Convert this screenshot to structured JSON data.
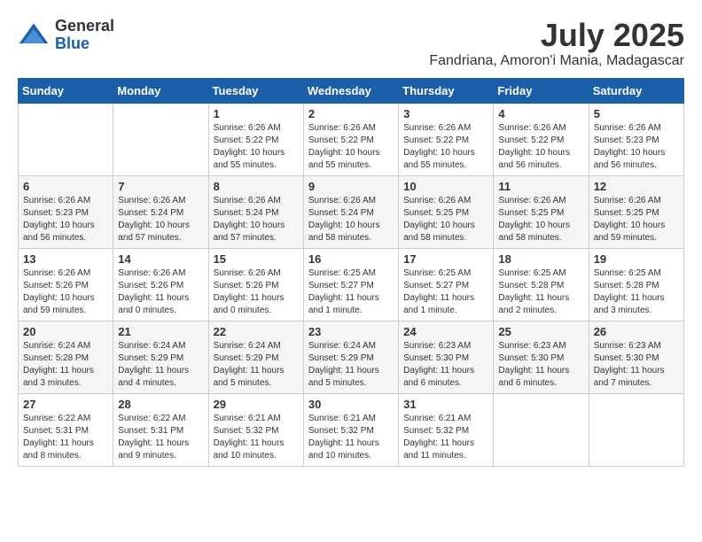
{
  "header": {
    "logo_general": "General",
    "logo_blue": "Blue",
    "month_year": "July 2025",
    "location": "Fandriana, Amoron'i Mania, Madagascar"
  },
  "weekdays": [
    "Sunday",
    "Monday",
    "Tuesday",
    "Wednesday",
    "Thursday",
    "Friday",
    "Saturday"
  ],
  "weeks": [
    [
      {
        "day": "",
        "info": ""
      },
      {
        "day": "",
        "info": ""
      },
      {
        "day": "1",
        "info": "Sunrise: 6:26 AM\nSunset: 5:22 PM\nDaylight: 10 hours\nand 55 minutes."
      },
      {
        "day": "2",
        "info": "Sunrise: 6:26 AM\nSunset: 5:22 PM\nDaylight: 10 hours\nand 55 minutes."
      },
      {
        "day": "3",
        "info": "Sunrise: 6:26 AM\nSunset: 5:22 PM\nDaylight: 10 hours\nand 55 minutes."
      },
      {
        "day": "4",
        "info": "Sunrise: 6:26 AM\nSunset: 5:22 PM\nDaylight: 10 hours\nand 56 minutes."
      },
      {
        "day": "5",
        "info": "Sunrise: 6:26 AM\nSunset: 5:23 PM\nDaylight: 10 hours\nand 56 minutes."
      }
    ],
    [
      {
        "day": "6",
        "info": "Sunrise: 6:26 AM\nSunset: 5:23 PM\nDaylight: 10 hours\nand 56 minutes."
      },
      {
        "day": "7",
        "info": "Sunrise: 6:26 AM\nSunset: 5:24 PM\nDaylight: 10 hours\nand 57 minutes."
      },
      {
        "day": "8",
        "info": "Sunrise: 6:26 AM\nSunset: 5:24 PM\nDaylight: 10 hours\nand 57 minutes."
      },
      {
        "day": "9",
        "info": "Sunrise: 6:26 AM\nSunset: 5:24 PM\nDaylight: 10 hours\nand 58 minutes."
      },
      {
        "day": "10",
        "info": "Sunrise: 6:26 AM\nSunset: 5:25 PM\nDaylight: 10 hours\nand 58 minutes."
      },
      {
        "day": "11",
        "info": "Sunrise: 6:26 AM\nSunset: 5:25 PM\nDaylight: 10 hours\nand 58 minutes."
      },
      {
        "day": "12",
        "info": "Sunrise: 6:26 AM\nSunset: 5:25 PM\nDaylight: 10 hours\nand 59 minutes."
      }
    ],
    [
      {
        "day": "13",
        "info": "Sunrise: 6:26 AM\nSunset: 5:26 PM\nDaylight: 10 hours\nand 59 minutes."
      },
      {
        "day": "14",
        "info": "Sunrise: 6:26 AM\nSunset: 5:26 PM\nDaylight: 11 hours\nand 0 minutes."
      },
      {
        "day": "15",
        "info": "Sunrise: 6:26 AM\nSunset: 5:26 PM\nDaylight: 11 hours\nand 0 minutes."
      },
      {
        "day": "16",
        "info": "Sunrise: 6:25 AM\nSunset: 5:27 PM\nDaylight: 11 hours\nand 1 minute."
      },
      {
        "day": "17",
        "info": "Sunrise: 6:25 AM\nSunset: 5:27 PM\nDaylight: 11 hours\nand 1 minute."
      },
      {
        "day": "18",
        "info": "Sunrise: 6:25 AM\nSunset: 5:28 PM\nDaylight: 11 hours\nand 2 minutes."
      },
      {
        "day": "19",
        "info": "Sunrise: 6:25 AM\nSunset: 5:28 PM\nDaylight: 11 hours\nand 3 minutes."
      }
    ],
    [
      {
        "day": "20",
        "info": "Sunrise: 6:24 AM\nSunset: 5:28 PM\nDaylight: 11 hours\nand 3 minutes."
      },
      {
        "day": "21",
        "info": "Sunrise: 6:24 AM\nSunset: 5:29 PM\nDaylight: 11 hours\nand 4 minutes."
      },
      {
        "day": "22",
        "info": "Sunrise: 6:24 AM\nSunset: 5:29 PM\nDaylight: 11 hours\nand 5 minutes."
      },
      {
        "day": "23",
        "info": "Sunrise: 6:24 AM\nSunset: 5:29 PM\nDaylight: 11 hours\nand 5 minutes."
      },
      {
        "day": "24",
        "info": "Sunrise: 6:23 AM\nSunset: 5:30 PM\nDaylight: 11 hours\nand 6 minutes."
      },
      {
        "day": "25",
        "info": "Sunrise: 6:23 AM\nSunset: 5:30 PM\nDaylight: 11 hours\nand 6 minutes."
      },
      {
        "day": "26",
        "info": "Sunrise: 6:23 AM\nSunset: 5:30 PM\nDaylight: 11 hours\nand 7 minutes."
      }
    ],
    [
      {
        "day": "27",
        "info": "Sunrise: 6:22 AM\nSunset: 5:31 PM\nDaylight: 11 hours\nand 8 minutes."
      },
      {
        "day": "28",
        "info": "Sunrise: 6:22 AM\nSunset: 5:31 PM\nDaylight: 11 hours\nand 9 minutes."
      },
      {
        "day": "29",
        "info": "Sunrise: 6:21 AM\nSunset: 5:32 PM\nDaylight: 11 hours\nand 10 minutes."
      },
      {
        "day": "30",
        "info": "Sunrise: 6:21 AM\nSunset: 5:32 PM\nDaylight: 11 hours\nand 10 minutes."
      },
      {
        "day": "31",
        "info": "Sunrise: 6:21 AM\nSunset: 5:32 PM\nDaylight: 11 hours\nand 11 minutes."
      },
      {
        "day": "",
        "info": ""
      },
      {
        "day": "",
        "info": ""
      }
    ]
  ]
}
